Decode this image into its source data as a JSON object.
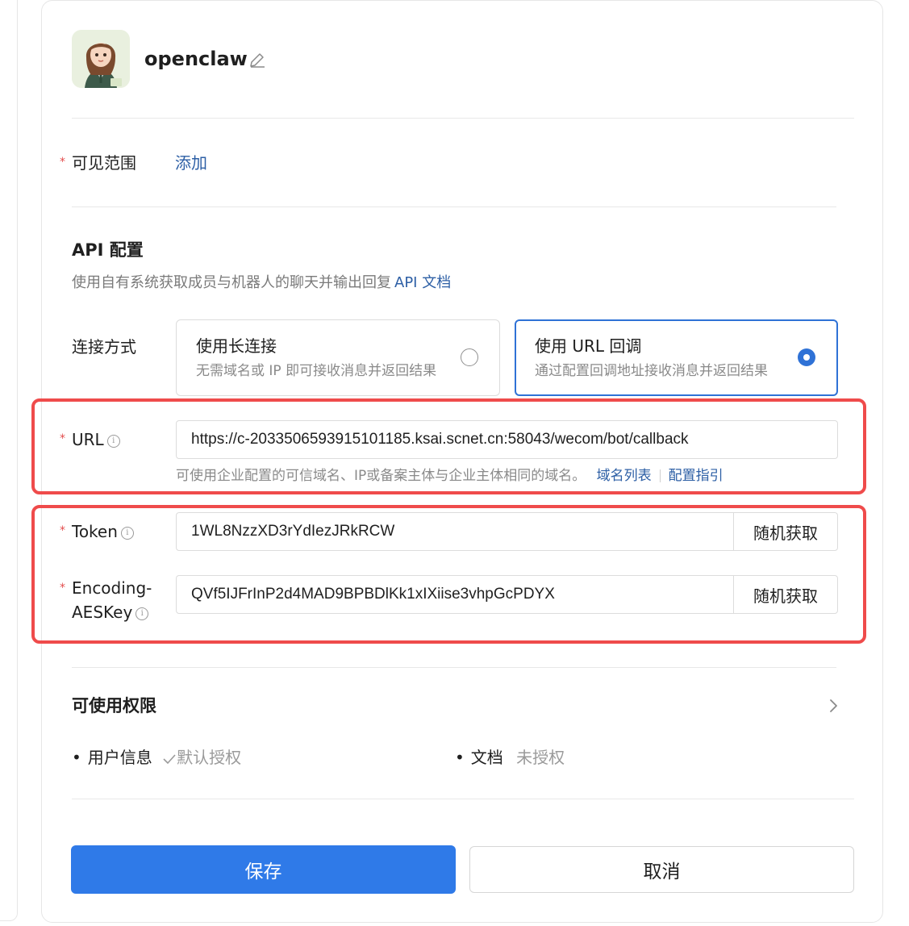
{
  "bot": {
    "name": "openclaw",
    "avatar_icon": "avatar-girl-illustration",
    "edit_icon": "edit-pencil-icon"
  },
  "visibility": {
    "label": "可见范围",
    "action": "添加"
  },
  "api": {
    "title": "API 配置",
    "description": "使用自有系统获取成员与机器人的聊天并输出回复",
    "doc_link": "API 文档",
    "connection_label": "连接方式",
    "options": [
      {
        "title": "使用长连接",
        "description": "无需域名或 IP 即可接收消息并返回结果",
        "selected": false
      },
      {
        "title": "使用 URL 回调",
        "description": "通过配置回调地址接收消息并返回结果",
        "selected": true
      }
    ],
    "url": {
      "label": "URL",
      "value": "https://c-2033506593915101185.ksai.scnet.cn:58043/wecom/bot/callback",
      "hint": "可使用企业配置的可信域名、IP或备案主体与企业主体相同的域名。",
      "link_domains": "域名列表",
      "link_guide": "配置指引"
    },
    "token": {
      "label": "Token",
      "value": "1WL8NzzXD3rYdIezJRkRCW",
      "button": "随机获取"
    },
    "aes_key": {
      "label_line1": "Encoding-",
      "label_line2": "AESKey",
      "value": "QVf5IJFrInP2d4MAD9BPBDlKk1xIXiise3vhpGcPDYX",
      "button": "随机获取"
    }
  },
  "permissions": {
    "title": "可使用权限",
    "items": [
      {
        "name": "用户信息",
        "status": "默认授权",
        "granted": true
      },
      {
        "name": "文档",
        "status": "未授权",
        "granted": false
      }
    ]
  },
  "footer": {
    "save": "保存",
    "cancel": "取消"
  },
  "colors": {
    "primary": "#2f7ae8",
    "link": "#2d5fa5",
    "required": "#e34d4d",
    "highlight": "#ef4b4b",
    "selected_border": "#2f72d6"
  }
}
